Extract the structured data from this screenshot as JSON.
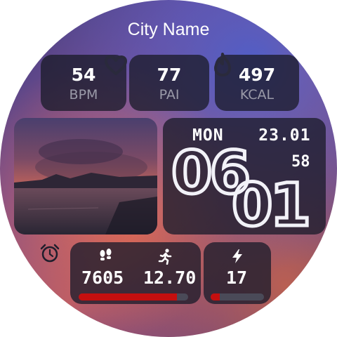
{
  "city": "City Name",
  "stats": [
    {
      "value": "54",
      "label": "BPM"
    },
    {
      "value": "77",
      "label": "PAI"
    },
    {
      "value": "497",
      "label": "KCAL"
    }
  ],
  "date": {
    "day": "MON",
    "date": "23.01"
  },
  "time": {
    "hours": "06",
    "minutes": "01",
    "seconds": "58"
  },
  "activity": {
    "steps": "7605",
    "distance": "12.70",
    "steps_progress": 0.9
  },
  "battery": {
    "value": "17",
    "progress": 0.17
  },
  "colors": {
    "accent_red": "#c40f0f",
    "card_bg": "#1c1c2c",
    "label_gray": "#9a9aa8"
  },
  "icons": [
    "heart-icon",
    "flame-icon",
    "alarm-clock-icon",
    "footsteps-icon",
    "running-icon",
    "lightning-icon"
  ]
}
